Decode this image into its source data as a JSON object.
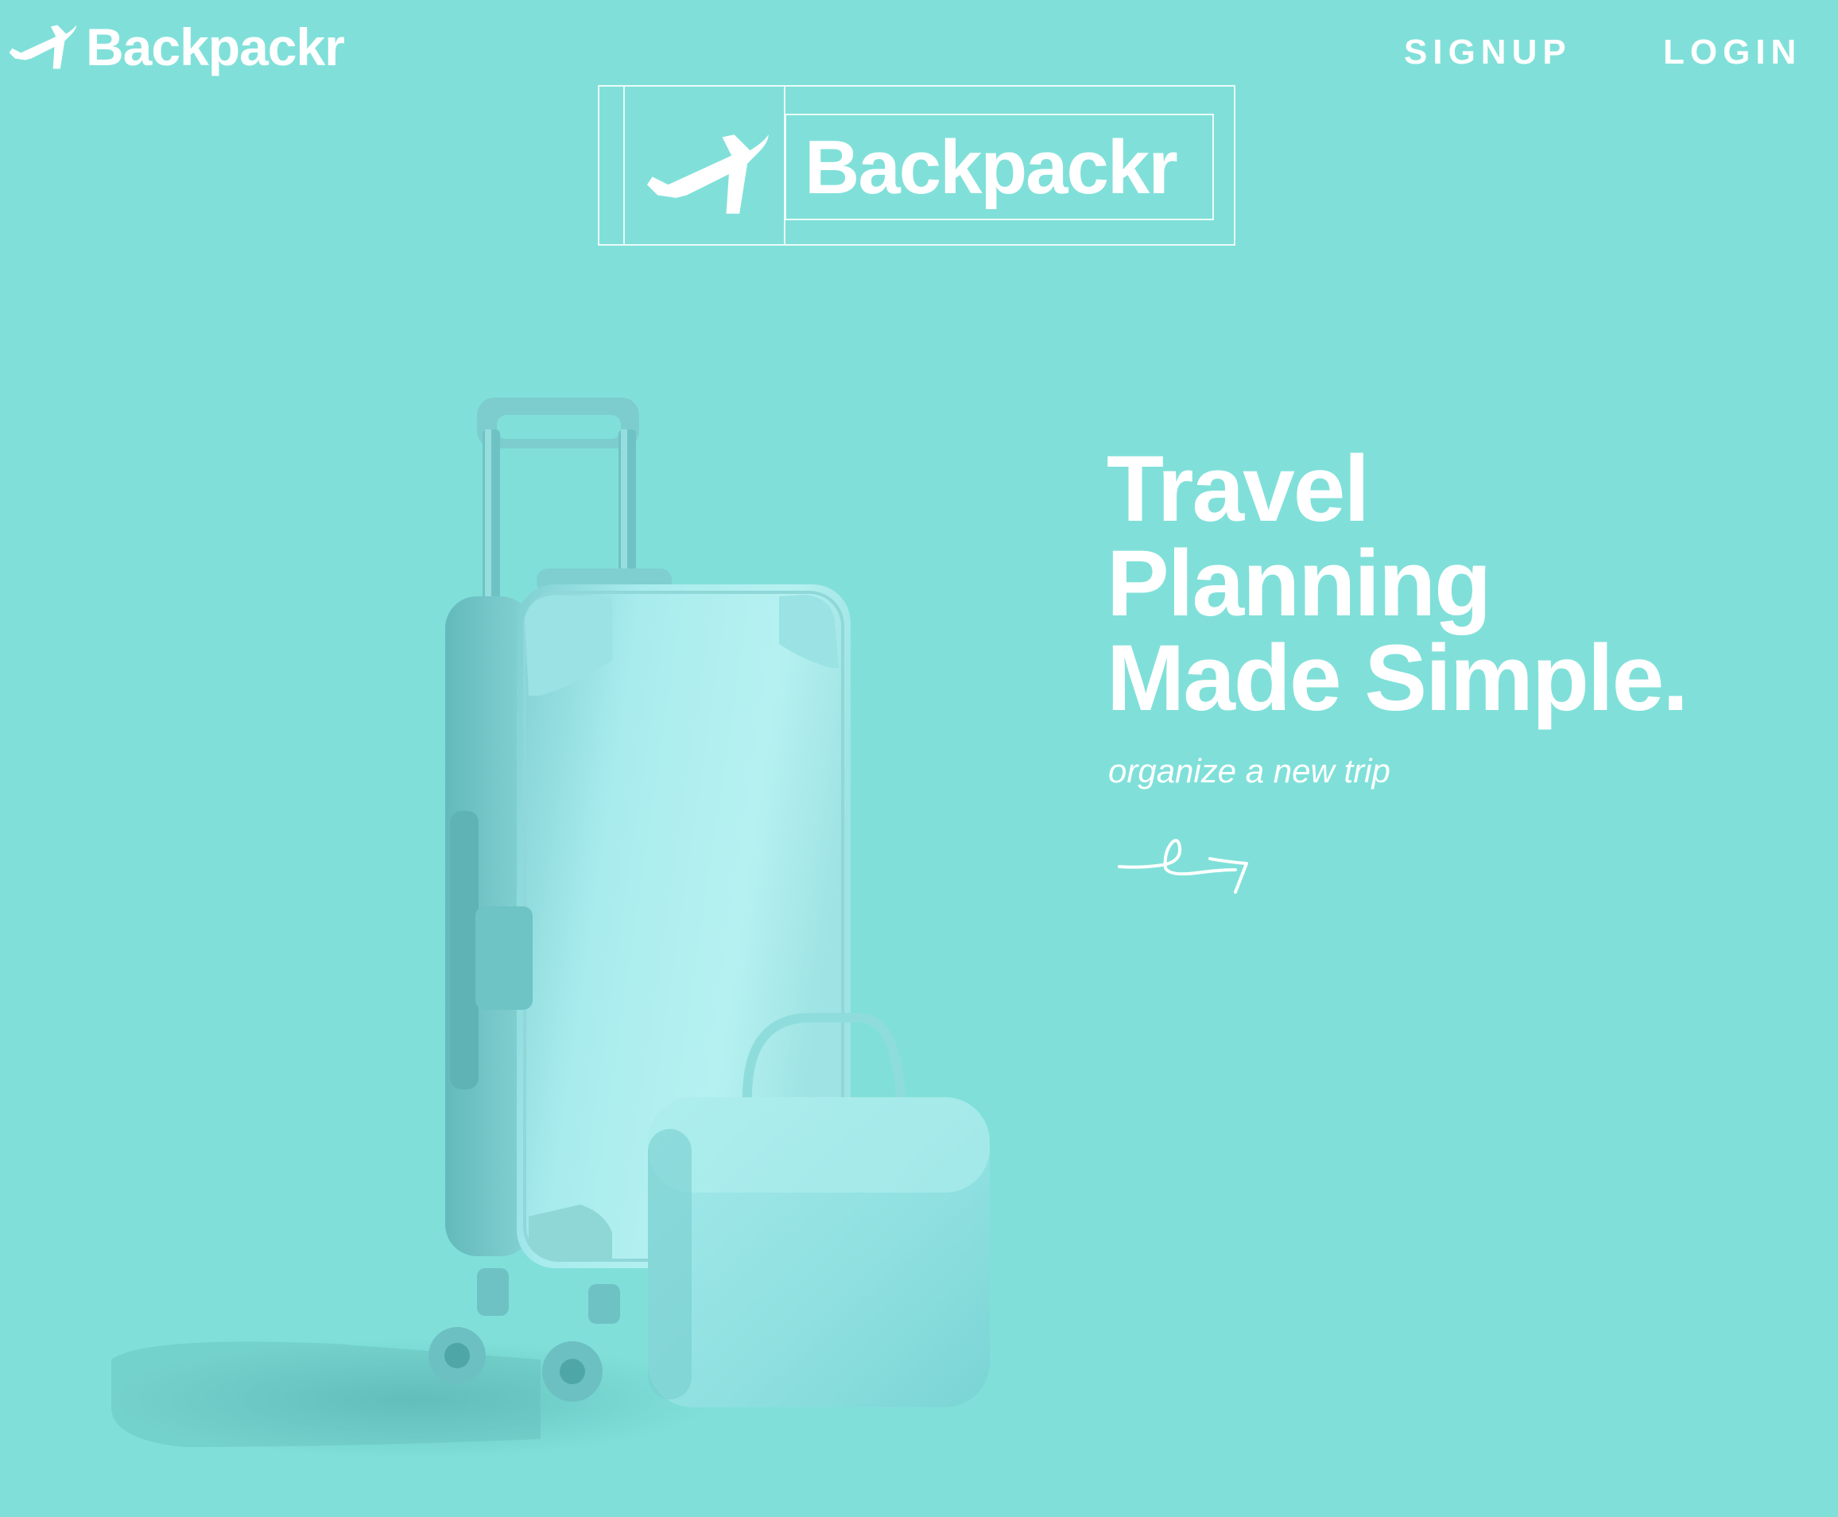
{
  "header": {
    "logo_text": "Backpackr",
    "logo_icon": "airplane-icon",
    "nav": {
      "signup_label": "SIGNUP",
      "login_label": "LOGIN"
    }
  },
  "brand_mark": {
    "text": "Backpackr",
    "icon": "airplane-icon"
  },
  "hero": {
    "title_lines": [
      "Travel",
      "Planning",
      "Made Simple."
    ],
    "subtitle": "organize a new trip",
    "arrow_icon": "hand-drawn-arrow-icon",
    "image": "suitcase-and-briefcase-illustration"
  },
  "colors": {
    "background": "#80e0d9",
    "text": "#ffffff",
    "luggage_light": "#b4f1ef",
    "luggage_mid": "#8fdcdc",
    "luggage_dark": "#5bb8b8"
  }
}
